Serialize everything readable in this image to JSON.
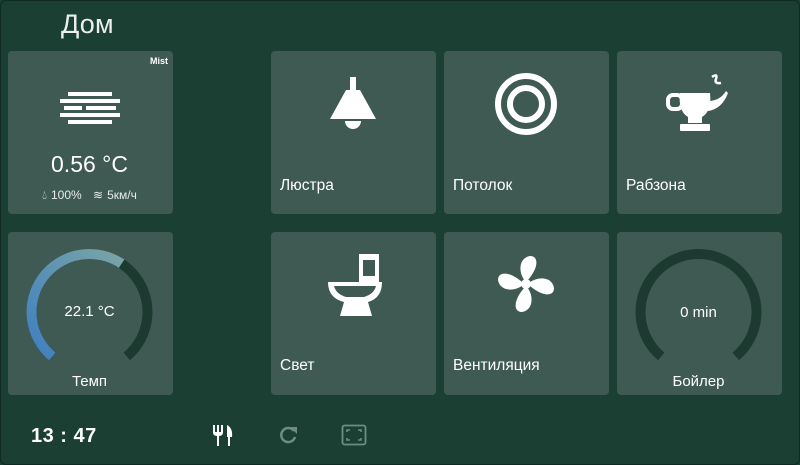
{
  "header": {
    "title": "Дом"
  },
  "weather": {
    "condition": "Mist",
    "temperature": "0.56 °C",
    "humidity": "100%",
    "wind": "5км/ч",
    "icon": "fog-icon"
  },
  "temp_gauge": {
    "value": "22.1 °C",
    "label": "Темп",
    "fill_fraction": 0.62
  },
  "tiles": [
    {
      "label": "Люстра",
      "icon": "ceiling-lamp-icon"
    },
    {
      "label": "Потолок",
      "icon": "ring-light-icon"
    },
    {
      "label": "Рабзона",
      "icon": "teapot-icon"
    },
    {
      "label": "Свет",
      "icon": "toilet-icon"
    },
    {
      "label": "Вентиляция",
      "icon": "fan-icon"
    }
  ],
  "boiler": {
    "value": "0 min",
    "label": "Бойлер",
    "fill_fraction": 0
  },
  "bottom_bar": {
    "time": "13 : 47",
    "icons": [
      "fork-knife-icon",
      "refresh-icon",
      "fullscreen-icon"
    ]
  },
  "colors": {
    "background": "#1b3f33",
    "tile": "#3f5a53",
    "gauge_track": "#1d3a31",
    "gauge_fill_start": "#4a86b8",
    "gauge_fill_end": "#6f9ca1"
  }
}
